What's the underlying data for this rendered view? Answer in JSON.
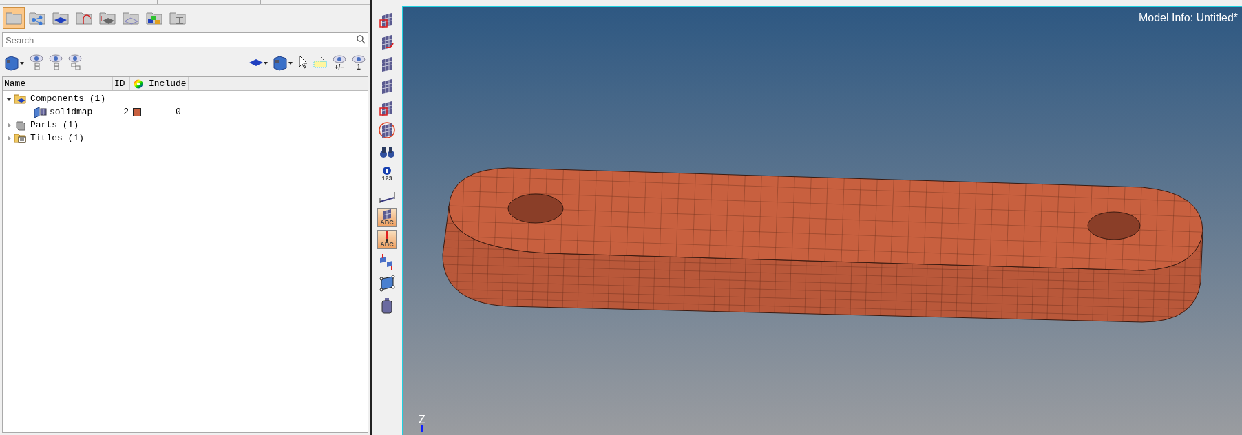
{
  "browser_views": [
    {
      "kind": "model",
      "selected": true
    },
    {
      "kind": "connectivity",
      "selected": false
    },
    {
      "kind": "component",
      "selected": false
    },
    {
      "kind": "loadcase",
      "selected": false
    },
    {
      "kind": "thickness",
      "selected": false
    },
    {
      "kind": "mesh",
      "selected": false
    },
    {
      "kind": "assembly",
      "selected": false
    },
    {
      "kind": "beam",
      "selected": false
    }
  ],
  "search": {
    "placeholder": "Search"
  },
  "browser_tools_left": [
    {
      "kind": "display"
    },
    {
      "kind": "eye-tree"
    },
    {
      "kind": "eye-tree"
    },
    {
      "kind": "eye-swap"
    }
  ],
  "browser_tools_right": [
    {
      "kind": "component"
    },
    {
      "kind": "display"
    },
    {
      "kind": "cursor"
    },
    {
      "kind": "highlight"
    },
    {
      "kind": "eye",
      "label": "+/−"
    },
    {
      "kind": "eye",
      "label": "1"
    }
  ],
  "table": {
    "columns": [
      "Name",
      "ID",
      "Include"
    ],
    "rows": [
      {
        "kind": "components",
        "name": "Components (1)",
        "expanded": true,
        "children": [
          {
            "kind": "component",
            "name": "solidmap",
            "id": "2",
            "color": "#c8603f",
            "include": "0"
          }
        ]
      },
      {
        "kind": "parts",
        "name": "Parts (1)",
        "expanded": false
      },
      {
        "kind": "titles",
        "name": "Titles (1)",
        "expanded": false
      }
    ]
  },
  "side_toolbar": [
    {
      "kind": "mesh-box",
      "selected": false
    },
    {
      "kind": "mesh-arrow",
      "selected": false
    },
    {
      "kind": "mesh",
      "selected": false
    },
    {
      "kind": "mesh",
      "selected": false
    },
    {
      "kind": "mesh-box",
      "selected": false
    },
    {
      "kind": "mesh-circle",
      "selected": false
    },
    {
      "kind": "binoculars",
      "selected": false
    },
    {
      "kind": "info",
      "label": "123",
      "selected": false
    },
    {
      "kind": "ruler",
      "selected": false
    },
    {
      "kind": "abc",
      "label": "ABC",
      "selected": true
    },
    {
      "kind": "abc-pin",
      "label": "ABC",
      "selected": true
    },
    {
      "kind": "swap",
      "selected": false
    },
    {
      "kind": "quad",
      "selected": false
    },
    {
      "kind": "weight",
      "selected": false
    }
  ],
  "viewport": {
    "model_info": "Model Info: Untitled*",
    "axis_label": "Z"
  }
}
